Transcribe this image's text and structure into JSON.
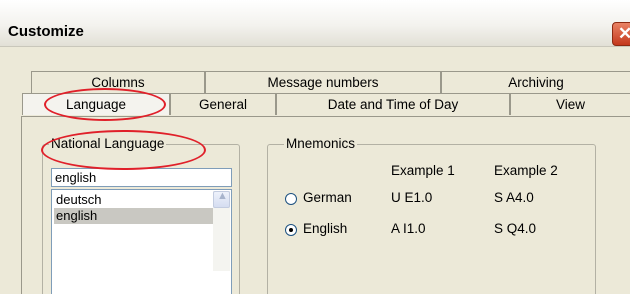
{
  "window": {
    "title": "Customize"
  },
  "tabs": {
    "row1": [
      "Columns",
      "Message numbers",
      "Archiving"
    ],
    "row2": [
      "Language",
      "General",
      "Date and Time of Day",
      "View"
    ],
    "active": "Language"
  },
  "national_language": {
    "legend": "National Language",
    "current_value": "english",
    "options": [
      "deutsch",
      "english"
    ],
    "selected": "english"
  },
  "mnemonics": {
    "legend": "Mnemonics",
    "col1_header": "Example 1",
    "col2_header": "Example 2",
    "rows": [
      {
        "label": "German",
        "example1": "U E1.0",
        "example2": "S A4.0",
        "checked": false
      },
      {
        "label": "English",
        "example1": "A I1.0",
        "example2": "S Q4.0",
        "checked": true
      }
    ]
  },
  "annotation_color": "#e0202a",
  "icons": {
    "close": "close-icon",
    "scroll_up": "scroll-up-arrow-icon"
  }
}
